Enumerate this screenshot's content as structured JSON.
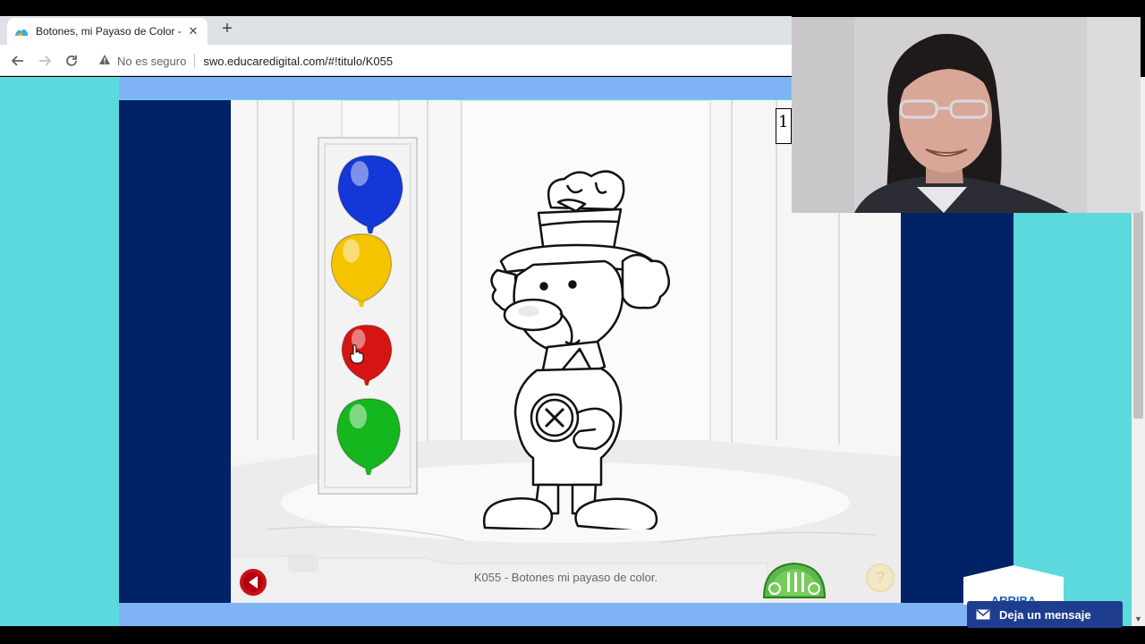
{
  "browser": {
    "tab_title": "Botones, mi Payaso de Color - Sc",
    "close_glyph": "✕",
    "new_tab_glyph": "+",
    "security_label": "No es seguro",
    "url": "swo.educaredigital.com/#!titulo/K055"
  },
  "game": {
    "page_number": "1",
    "subtitle": "K055 - Botones mi payaso de color.",
    "help_glyph": "?",
    "palette": [
      {
        "name": "blue",
        "color": "#1437d8"
      },
      {
        "name": "yellow",
        "color": "#f5c400"
      },
      {
        "name": "red",
        "color": "#d61414"
      },
      {
        "name": "green",
        "color": "#14b81e"
      }
    ]
  },
  "page": {
    "arriba_label": "ARRIBA",
    "chat_label": "Deja un mensaje"
  },
  "colors": {
    "cyan_background": "#5cd9dd",
    "navy": "#002266",
    "light_blue_bar": "#80b3f5"
  }
}
